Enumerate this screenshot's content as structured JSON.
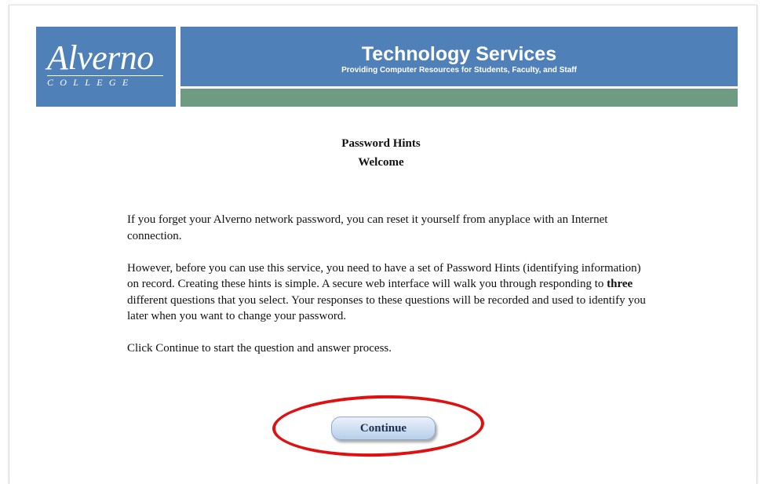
{
  "brand": {
    "logo_word": "Alverno",
    "logo_sub": "COLLEGE",
    "title": "Technology Services",
    "subtitle": "Providing Computer Resources for Students, Faculty, and Staff",
    "colors": {
      "blue": "#4f80b8",
      "green": "#6f9b83"
    }
  },
  "page": {
    "heading": "Password Hints",
    "subheading": "Welcome"
  },
  "content": {
    "p1": "If you forget your Alverno network password, you can reset it yourself from anyplace with an Internet connection.",
    "p2_a": "However, before you can use this service, you need to have a set of Password Hints (identifying information) on record. Creating these hints is simple. A secure web interface will walk you through responding to ",
    "p2_bold": "three",
    "p2_b": " different questions that you select. Your responses to these questions will be recorded and used to identify you later when you want to change your password.",
    "p3": "Click Continue to start the question and answer process."
  },
  "actions": {
    "continue_label": "Continue",
    "highlight_color": "#e01010"
  }
}
